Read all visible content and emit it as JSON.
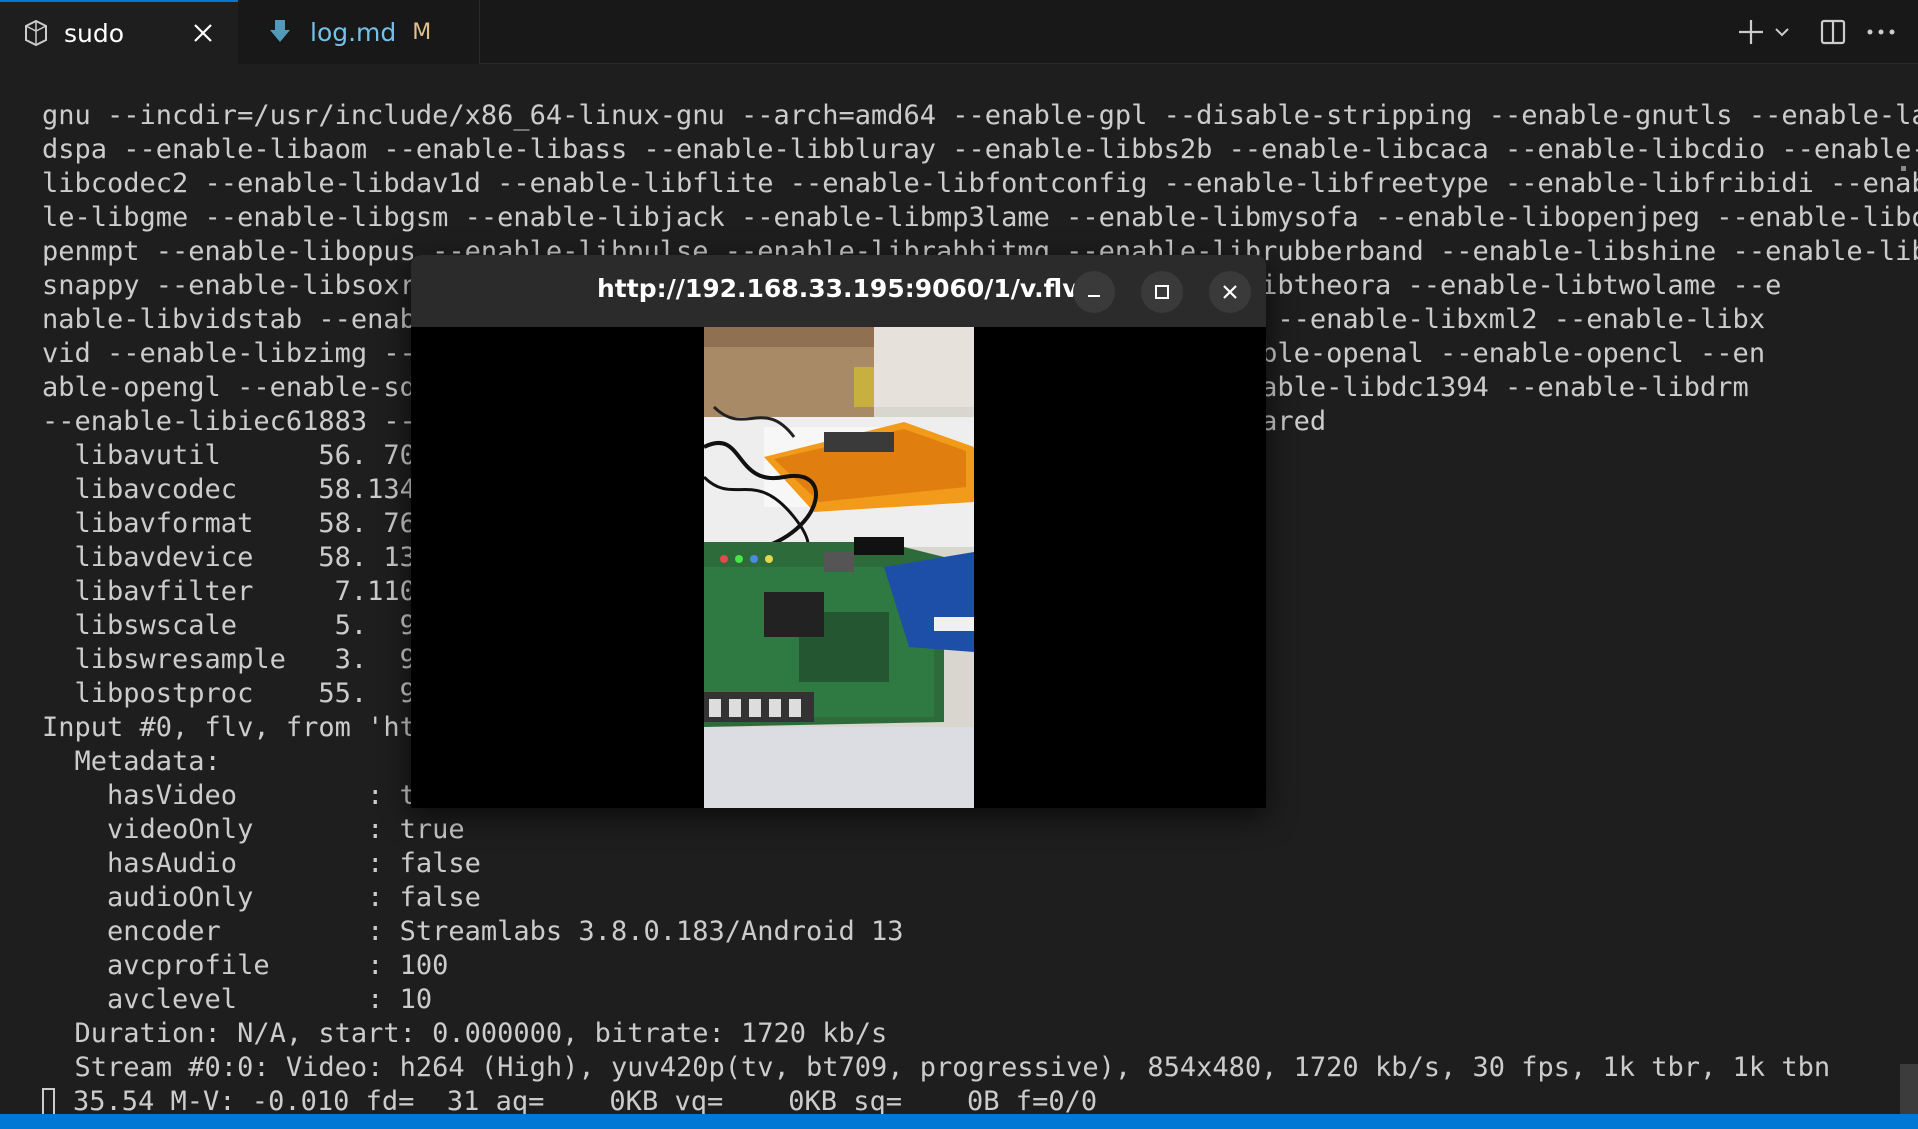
{
  "tabs": [
    {
      "label": "sudo",
      "active": true,
      "icon": "terminal-icon"
    },
    {
      "label": "log.md",
      "active": false,
      "icon": "markdown-download-icon",
      "modified_badge": "M"
    }
  ],
  "actions": {
    "new_terminal": "plus-icon",
    "dropdown": "chevron-down-icon",
    "split": "split-editor-icon",
    "more": "ellipsis-icon"
  },
  "terminal": {
    "lines": [
      "gnu --incdir=/usr/include/x86_64-linux-gnu --arch=amd64 --enable-gpl --disable-stripping --enable-gnutls --enable-la",
      "dspa --enable-libaom --enable-libass --enable-libbluray --enable-libbs2b --enable-libcaca --enable-libcdio --enable-",
      "libcodec2 --enable-libdav1d --enable-libflite --enable-libfontconfig --enable-libfreetype --enable-libfribidi --enab",
      "le-libgme --enable-libgsm --enable-libjack --enable-libmp3lame --enable-libmysofa --enable-libopenjpeg --enable-libo",
      "penmpt --enable-libopus --enable-libpulse --enable-librabbitmq --enable-librubberband --enable-libshine --enable-lib",
      "snappy --enable-libsoxr                                            enable-libtheora --enable-libtwolame --e",
      "nable-libvidstab --enab                                           e-libx265 --enable-libxml2 --enable-libx",
      "vid --enable-libzimg --                                           omx --enable-openal --enable-opencl --en",
      "able-opengl --enable-sd                                           omfx --enable-libdc1394 --enable-libdrm",
      "--enable-libiec61883 --                                           enable-shared",
      "  libavutil      56. 70",
      "  libavcodec     58.134",
      "  libavformat    58. 76",
      "  libavdevice    58. 13",
      "  libavfilter     7.110",
      "  libswscale      5.  9",
      "  libswresample   3.  9",
      "  libpostproc    55.  9",
      "Input #0, flv, from 'ht",
      "  Metadata:",
      "    hasVideo        : t",
      "    videoOnly       : true",
      "    hasAudio        : false",
      "    audioOnly       : false",
      "    encoder         : Streamlabs 3.8.0.183/Android 13",
      "    avcprofile      : 100",
      "    avclevel        : 10",
      "  Duration: N/A, start: 0.000000, bitrate: 1720 kb/s",
      "  Stream #0:0: Video: h264 (High), yuv420p(tv, bt709, progressive), 854x480, 1720 kb/s, 30 fps, 1k tbr, 1k tbn"
    ],
    "status_line": "35.54 M-V: -0.010 fd=  31 aq=    0KB vq=    0KB sq=    0B f=0/0"
  },
  "video_window": {
    "title": "http://192.168.33.195:9060/1/v.flv",
    "buttons": [
      "minimize-icon",
      "maximize-icon",
      "close-icon"
    ],
    "content": "video-frame-electronics-board"
  },
  "colors": {
    "accent": "#0078d4",
    "terminal_bg": "#1e1e1e",
    "terminal_fg": "#cccccc",
    "modified": "#e2c08d",
    "markdown_icon": "#519aba"
  }
}
